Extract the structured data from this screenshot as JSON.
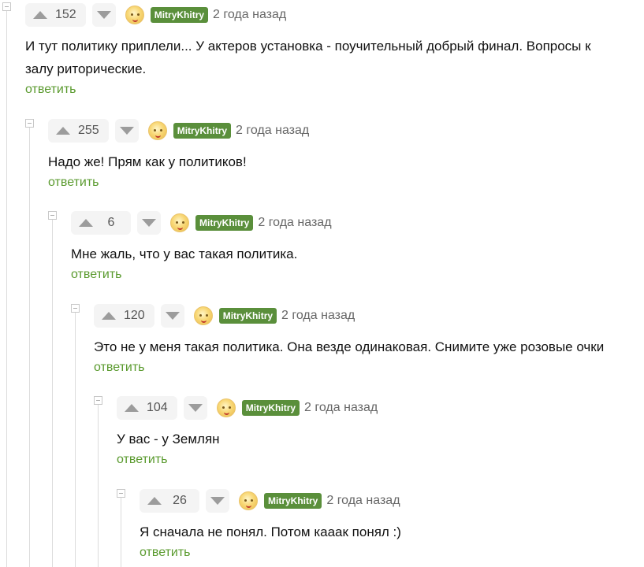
{
  "reply_label": "ответить",
  "comments": [
    {
      "score": "152",
      "author": "MitryKhitry",
      "time": "2 года назад",
      "text": "И тут политику приплели... У актеров установка - поучительный добрый финал. Вопросы к залу риторические."
    },
    {
      "score": "255",
      "author": "MitryKhitry",
      "time": "2 года назад",
      "text": "Надо же! Прям как у политиков!"
    },
    {
      "score": "6",
      "author": "MitryKhitry",
      "time": "2 года назад",
      "text": "Мне жаль, что у вас такая политика."
    },
    {
      "score": "120",
      "author": "MitryKhitry",
      "time": "2 года назад",
      "text": "Это не у меня такая политика. Она везде одинаковая. Снимите уже розовые очки"
    },
    {
      "score": "104",
      "author": "MitryKhitry",
      "time": "2 года назад",
      "text": "У вас - у Землян"
    },
    {
      "score": "26",
      "author": "MitryKhitry",
      "time": "2 года назад",
      "text": "Я сначала не понял. Потом кааак понял :)"
    }
  ]
}
